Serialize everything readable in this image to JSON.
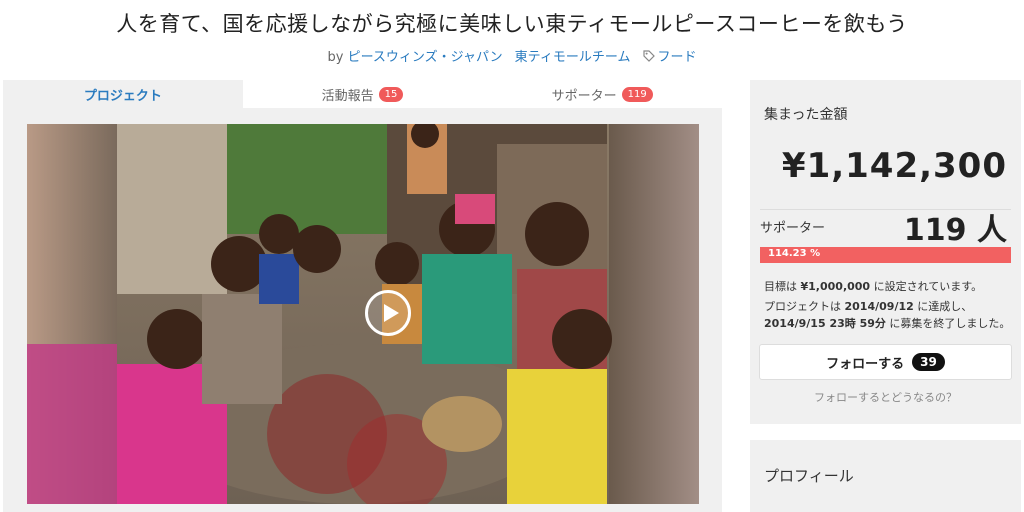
{
  "project": {
    "title": "人を育て、国を応援しながら究極に美味しい東ティモールピースコーヒーを飲もう",
    "by_prefix": "by",
    "owner1": "ピースウィンズ・ジャパン",
    "owner2": "東ティモールチーム",
    "category": "フード"
  },
  "tabs": [
    {
      "label": "プロジェクト",
      "badge": ""
    },
    {
      "label": "活動報告",
      "badge": "15"
    },
    {
      "label": "サポーター",
      "badge": "119"
    }
  ],
  "stats": {
    "raised_label": "集まった金額",
    "raised_amount": "¥1,142,300",
    "supporters_label": "サポーター",
    "supporters_count": "119 人",
    "progress_text": "114.23 %",
    "progress_value": 1.0,
    "goal_pre": "目標は",
    "goal_amount": "¥1,000,000",
    "goal_post": "に設定されています。",
    "done_pre": "プロジェクトは",
    "done_date1": "2014/09/12",
    "done_mid": "に達成し、",
    "done_date2": "2014/9/15 23時 59分",
    "done_post": "に募集を終了しました。"
  },
  "follow": {
    "label": "フォローする",
    "count": "39",
    "help": "フォローするとどうなるの？"
  },
  "profile": {
    "title": "プロフィール"
  },
  "colors": {
    "accent": "#2a7bbf",
    "badge": "#f05a5a",
    "progress": "#f26161"
  }
}
